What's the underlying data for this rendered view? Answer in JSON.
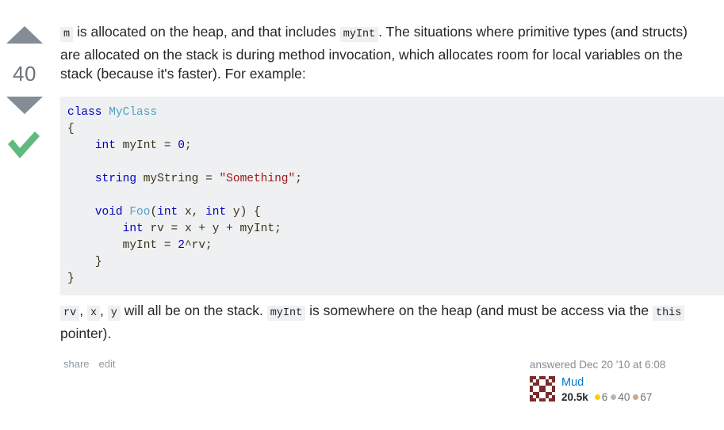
{
  "vote": {
    "count": "40",
    "up_icon": "vote-up-arrow-icon",
    "down_icon": "vote-down-arrow-icon",
    "accepted_icon": "accepted-answer-checkmark-icon",
    "accepted_color": "#5eba7d",
    "arrow_color": "#848d95"
  },
  "post": {
    "paragraph_1": {
      "code_1": "m",
      "text_1": " is allocated on the heap, and that includes ",
      "code_2": "myInt",
      "text_2": ". The situations where primitive types (and structs) are allocated on the stack is during method invocation, which allocates room for local variables on the stack (because it's faster). For example:"
    },
    "code_block": {
      "language": "csharp",
      "lines": [
        "class MyClass",
        "{",
        "    int myInt = 0;",
        "",
        "    string myString = \"Something\";",
        "",
        "    void Foo(int x, int y) {",
        "        int rv = x + y + myInt;",
        "        myInt = 2^rv;",
        "    }",
        "}"
      ]
    },
    "paragraph_2": {
      "code_1": "rv",
      "sep_1": ", ",
      "code_2": "x",
      "sep_2": ", ",
      "code_3": "y",
      "text_1": " will all be on the stack. ",
      "code_4": "myInt",
      "text_2": " is somewhere on the heap (and must be access via the ",
      "code_5": "this",
      "text_3": " pointer)."
    }
  },
  "actions": {
    "share_label": "share",
    "edit_label": "edit"
  },
  "signature": {
    "action_text": "answered Dec 20 '10 at 6:08",
    "username": "Mud",
    "reputation": "20.5k",
    "badges": {
      "gold_count": "6",
      "silver_count": "40",
      "bronze_count": "67",
      "gold_color": "#ffcc01",
      "silver_color": "#b4b8bc",
      "bronze_color": "#d1a684"
    },
    "avatar_icon": "user-avatar-identicon",
    "avatar_color": "#7b2b2b"
  }
}
